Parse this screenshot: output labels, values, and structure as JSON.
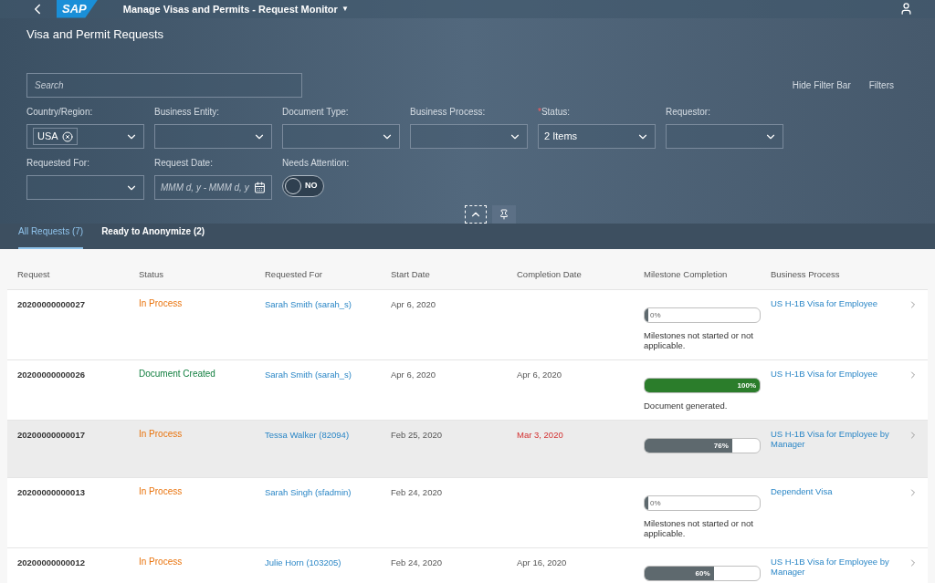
{
  "shell": {
    "title": "Manage Visas and Permits - Request Monitor",
    "logo": "SAP",
    "menu_mark": "▼"
  },
  "required_mark": "*",
  "page_title": "Visa and Permit Requests",
  "search": {
    "placeholder": "Search"
  },
  "filter_actions": [
    "Hide Filter Bar",
    "Filters"
  ],
  "filters": [
    {
      "kind": "select",
      "label": "Country/Region:",
      "required": false,
      "tokens": [
        "USA"
      ]
    },
    {
      "kind": "select",
      "label": "Business Entity:",
      "required": false
    },
    {
      "kind": "select",
      "label": "Document Type:",
      "required": false
    },
    {
      "kind": "select",
      "label": "Business Process:",
      "required": false
    },
    {
      "kind": "select",
      "label": "Status:",
      "required": true,
      "value": "2 Items"
    },
    {
      "kind": "select",
      "label": "Requestor:",
      "required": false
    },
    {
      "kind": "select",
      "label": "Requested For:",
      "required": false
    },
    {
      "kind": "date",
      "label": "Request Date:",
      "required": false,
      "placeholder": "MMM d, y - MMM d, y"
    },
    {
      "kind": "switch",
      "label": "Needs Attention:",
      "required": false,
      "on": false,
      "value": "NO"
    }
  ],
  "tabs": [
    {
      "label": "All Requests (7)",
      "selected": true
    },
    {
      "label": "Ready to Anonymize (2)",
      "selected": false
    }
  ],
  "table": {
    "columns": [
      "Request",
      "Status",
      "Requested For",
      "Start Date",
      "Completion Date",
      "Milestone Completion",
      "Business Process"
    ],
    "rows": [
      {
        "selected": false,
        "request": "20200000000027",
        "status": {
          "text": "In Process",
          "color": "#e9730c"
        },
        "requested_for": "Sarah Smith (sarah_s)",
        "start": "Apr 6, 2020",
        "milestone": {
          "level": 0,
          "label": "0%",
          "complete": false,
          "note": "Milestones not started or not applicable."
        },
        "process": "US H-1B Visa for Employee"
      },
      {
        "selected": false,
        "request": "20200000000026",
        "status": {
          "text": "Document Created",
          "color": "#107e3e"
        },
        "requested_for": "Sarah Smith (sarah_s)",
        "start": "Apr 6, 2020",
        "completion": "Apr 6, 2020",
        "overdue": false,
        "milestone": {
          "level": 1,
          "label": "100%",
          "complete": true,
          "note": "Document generated."
        },
        "process": "US H-1B Visa for Employee"
      },
      {
        "selected": true,
        "request": "20200000000017",
        "status": {
          "text": "In Process",
          "color": "#e9730c"
        },
        "requested_for": "Tessa Walker (82094)",
        "start": "Feb 25, 2020",
        "completion": "Mar 3, 2020",
        "overdue": true,
        "milestone": {
          "level": 0.76,
          "label": "76%",
          "complete": false
        },
        "process": "US H-1B Visa for Employee by Manager"
      },
      {
        "selected": false,
        "request": "20200000000013",
        "status": {
          "text": "In Process",
          "color": "#e9730c"
        },
        "requested_for": "Sarah Singh (sfadmin)",
        "start": "Feb 24, 2020",
        "milestone": {
          "level": 0,
          "label": "0%",
          "complete": false,
          "note": "Milestones not started or not applicable."
        },
        "process": "Dependent Visa"
      },
      {
        "selected": false,
        "request": "20200000000012",
        "status": {
          "text": "In Process",
          "color": "#e9730c"
        },
        "requested_for": "Julie Horn (103205)",
        "start": "Feb 24, 2020",
        "completion": "Apr 16, 2020",
        "overdue": false,
        "milestone": {
          "level": 0.6,
          "label": "60%",
          "complete": false
        },
        "process": "US H-1B Visa for Employee by Manager"
      }
    ]
  }
}
